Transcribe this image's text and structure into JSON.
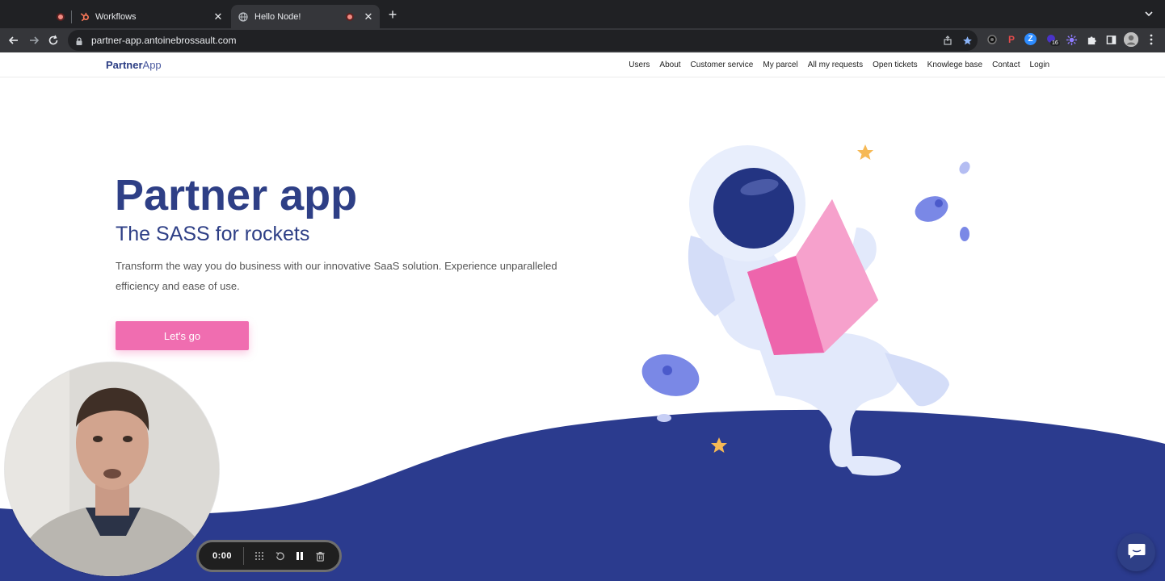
{
  "browser": {
    "tabs": [
      {
        "title": "Workflows",
        "active": false
      },
      {
        "title": "Hello Node!",
        "active": true
      }
    ],
    "url": "partner-app.antoinebrossault.com",
    "extension_badge": "16"
  },
  "site": {
    "brand_bold": "Partner",
    "brand_light": "App",
    "nav": [
      "Users",
      "About",
      "Customer service",
      "My parcel",
      "All my requests",
      "Open tickets",
      "Knowlege base",
      "Contact",
      "Login"
    ],
    "hero": {
      "title_bold": "Partner",
      "title_light": "app",
      "subtitle": "The SASS for rockets",
      "description": "Transform the way you do business with our innovative SaaS solution. Experience unparalleled efficiency and ease of use.",
      "cta_label": "Let's go"
    }
  },
  "recorder": {
    "time": "0:00"
  },
  "colors": {
    "brand": "#2e3f86",
    "accent_pink": "#f06db0",
    "wave_dark": "#2a3b8c"
  }
}
